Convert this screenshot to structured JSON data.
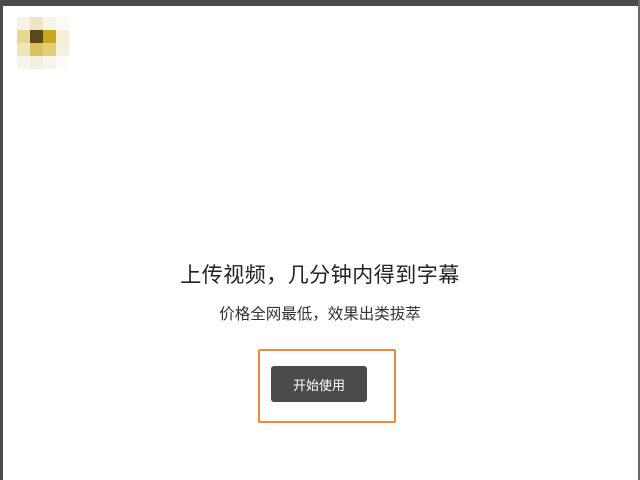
{
  "hero": {
    "title": "上传视频，几分钟内得到字幕",
    "subtitle": "价格全网最低，效果出类拔萃",
    "start_label": "开始使用"
  },
  "logo": {
    "icon": "blurred-logo-icon"
  },
  "colors": {
    "button_bg": "#4a4a4a",
    "highlight_border": "#f0883e",
    "text_dark": "#222222"
  }
}
